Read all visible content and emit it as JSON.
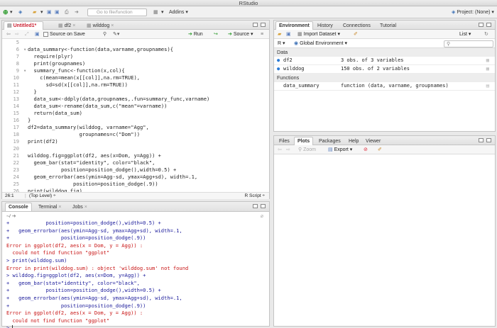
{
  "app": {
    "title": "RStudio"
  },
  "toolbar": {
    "goto_placeholder": "Go to file/function",
    "addins_label": "Addins",
    "project_label": "Project: (None)"
  },
  "source": {
    "tabs": [
      {
        "label": "Untitled1*",
        "active": true
      },
      {
        "label": "df2",
        "active": false
      },
      {
        "label": "wilddog",
        "active": false
      }
    ],
    "source_on_save": "Source on Save",
    "run_label": "Run",
    "source_label": "Source",
    "lines": [
      {
        "n": "5",
        "code": ""
      },
      {
        "n": "6",
        "code": "data_summary<-function(data,varname,groupnames){",
        "fold": true
      },
      {
        "n": "7",
        "code": "  require(plyr)"
      },
      {
        "n": "8",
        "code": "  print(groupnames)"
      },
      {
        "n": "9",
        "code": "  summary_func<-function(x,col){",
        "fold": true
      },
      {
        "n": "10",
        "code": "    c(mean=mean(x[[col]],na.rm=TRUE),"
      },
      {
        "n": "11",
        "code": "      sd=sd(x[[col]],na.rm=TRUE))"
      },
      {
        "n": "12",
        "code": "  }"
      },
      {
        "n": "13",
        "code": "  data_sum<-ddply(data,groupnames,.fun=summary_func,varname)"
      },
      {
        "n": "14",
        "code": "  data_sum<-rename(data_sum,c(\"mean\"=varname))"
      },
      {
        "n": "15",
        "code": "  return(data_sum)"
      },
      {
        "n": "16",
        "code": "}"
      },
      {
        "n": "17",
        "code": "df2=data_summary(wilddog, varname=\"Agg\","
      },
      {
        "n": "18",
        "code": "                 groupnames=c(\"Dom\"))"
      },
      {
        "n": "19",
        "code": "print(df2)"
      },
      {
        "n": "20",
        "code": ""
      },
      {
        "n": "21",
        "code": "wilddog.fig=ggplot(df2, aes(x=Dom, y=Agg)) +"
      },
      {
        "n": "22",
        "code": "  geom_bar(stat=\"identity\", color=\"black\","
      },
      {
        "n": "23",
        "code": "           position=position_dodge(),width=0.5) +"
      },
      {
        "n": "24",
        "code": "  geom_errorbar(aes(ymin=Agg-sd, ymax=Agg+sd), width=.1,"
      },
      {
        "n": "25",
        "code": "               position=position_dodge(.9))"
      },
      {
        "n": "26",
        "code": "print(wilddog.fig)"
      }
    ],
    "status_position": "26:1",
    "status_scope": "(Top Level)",
    "status_type": "R Script"
  },
  "console": {
    "tabs": [
      {
        "label": "Console",
        "active": true
      },
      {
        "label": "Terminal",
        "active": false
      },
      {
        "label": "Jobs",
        "active": false
      }
    ],
    "path": "~/",
    "lines": [
      {
        "text": "+            position=position_dodge(),width=0.5) +",
        "kind": "cmd"
      },
      {
        "text": "+   geom_errorbar(aes(ymin=Agg-sd, ymax=Agg+sd), width=.1,",
        "kind": "cmd"
      },
      {
        "text": "+                 position=position_dodge(.9))",
        "kind": "cmd"
      },
      {
        "text": "Error in ggplot(df2, aes(x = Dom, y = Agg)) :",
        "kind": "err"
      },
      {
        "text": "  could not find function \"ggplot\"",
        "kind": "err"
      },
      {
        "text": "> print(wilddog.sum)",
        "kind": "cmd"
      },
      {
        "text": "Error in print(wilddog.sum) : object 'wilddog.sum' not found",
        "kind": "err"
      },
      {
        "text": "> wilddog.fig=ggplot(df2, aes(x=Dom, y=Agg)) +",
        "kind": "cmd"
      },
      {
        "text": "+   geom_bar(stat=\"identity\", color=\"black\",",
        "kind": "cmd"
      },
      {
        "text": "+            position=position_dodge(),width=0.5) +",
        "kind": "cmd"
      },
      {
        "text": "+   geom_errorbar(aes(ymin=Agg-sd, ymax=Agg+sd), width=.1,",
        "kind": "cmd"
      },
      {
        "text": "+                 position=position_dodge(.9))",
        "kind": "cmd"
      },
      {
        "text": "Error in ggplot(df2, aes(x = Dom, y = Agg)) :",
        "kind": "err"
      },
      {
        "text": "  could not find function \"ggplot\"",
        "kind": "err"
      },
      {
        "text": ">",
        "kind": "cmd"
      }
    ]
  },
  "environment": {
    "tabs": [
      {
        "label": "Environment",
        "active": true
      },
      {
        "label": "History",
        "active": false
      },
      {
        "label": "Connections",
        "active": false
      },
      {
        "label": "Tutorial",
        "active": false
      }
    ],
    "import_label": "Import Dataset",
    "list_label": "List",
    "lang_label": "R",
    "scope_label": "Global Environment",
    "data_section": "Data",
    "functions_section": "Functions",
    "data": [
      {
        "name": "df2",
        "value": "3 obs. of 3 variables"
      },
      {
        "name": "wilddog",
        "value": "150 obs. of 2 variables"
      }
    ],
    "functions": [
      {
        "name": "data_summary",
        "value": "function (data, varname, groupnames)"
      }
    ]
  },
  "files": {
    "tabs": [
      {
        "label": "Files",
        "active": false
      },
      {
        "label": "Plots",
        "active": true
      },
      {
        "label": "Packages",
        "active": false
      },
      {
        "label": "Help",
        "active": false
      },
      {
        "label": "Viewer",
        "active": false
      }
    ],
    "zoom_label": "Zoom",
    "export_label": "Export"
  },
  "colors": {
    "accent": "#2b7bd6",
    "error": "#c81414",
    "console_text": "#1a1a9a",
    "string": "#1a8f1a"
  }
}
